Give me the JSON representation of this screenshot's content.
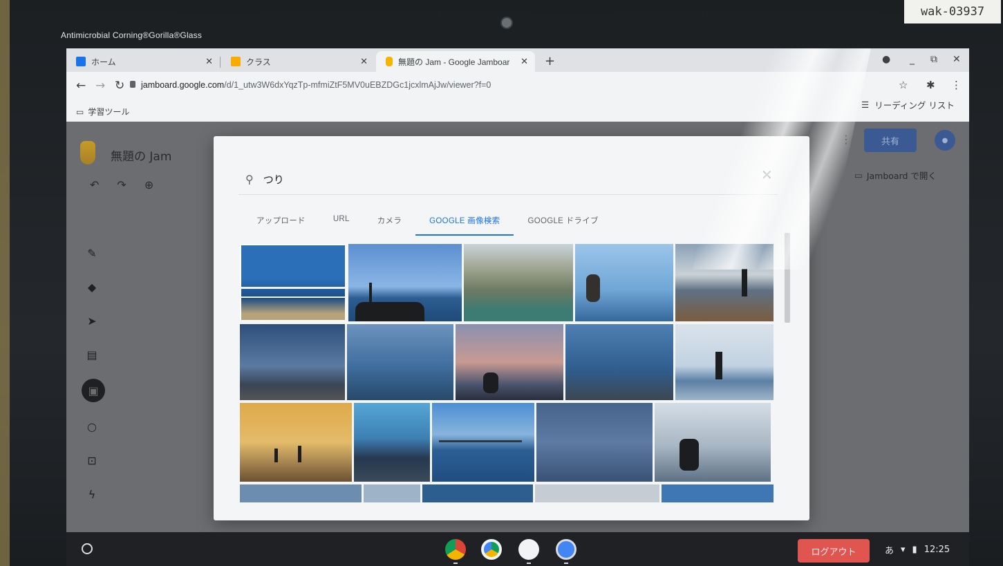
{
  "bezel": {
    "brand_text": "Antimicrobial Corning®Gorilla®Glass",
    "sticker": "wak-03937"
  },
  "browser": {
    "tabs": [
      {
        "title": "ホーム"
      },
      {
        "title": "クラス"
      },
      {
        "title": "無題の Jam - Google Jamboar"
      }
    ],
    "url_host": "jamboard.google.com",
    "url_path": "/d/1_utw3W6dxYqzTp-mfmiZtF5MV0uEBZDGc1jcxlmAjJw/viewer?f=0",
    "bookmark": "学習ツール",
    "reading_list": "リーディング リスト"
  },
  "jamboard": {
    "title": "無題の Jam",
    "share_label": "共有",
    "open_label": "Jamboard で開く"
  },
  "dialog": {
    "search_value": "つり",
    "tabs": [
      "アップロード",
      "URL",
      "カメラ",
      "GOOGLE 画像検索",
      "GOOGLE ドライブ"
    ],
    "active_tab": "GOOGLE 画像検索"
  },
  "shelf": {
    "logout_label": "ログアウト",
    "ime": "あ",
    "time": "12:25"
  },
  "colors": {
    "accent": "#1a73e8",
    "logout": "#e0554f",
    "share": "#3b5a93"
  }
}
